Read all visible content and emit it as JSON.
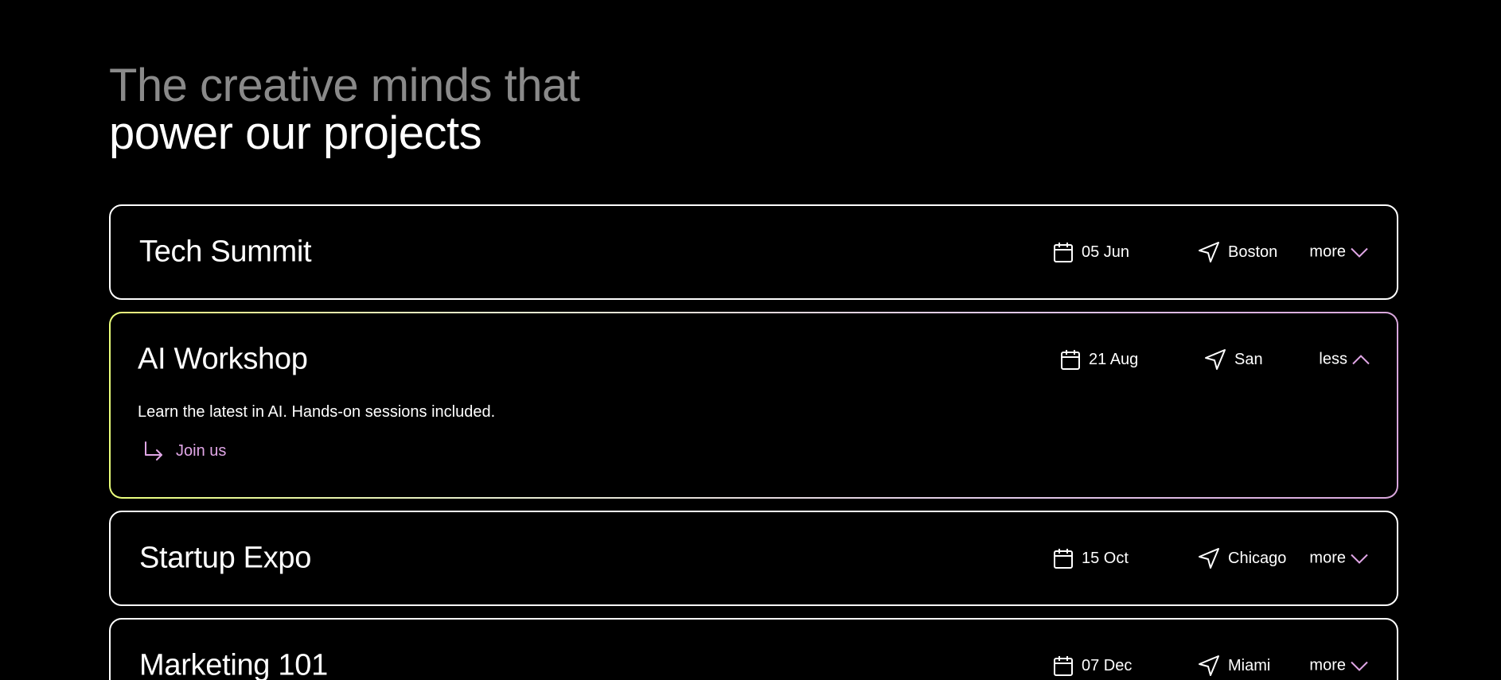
{
  "heading": {
    "line1": "The creative minds that",
    "line2": "power our projects"
  },
  "colors": {
    "background": "#000000",
    "muted_text": "#8a8a8a",
    "accent_pink": "#e0a6e6",
    "accent_lime": "#eaff7a"
  },
  "events": [
    {
      "title": "Tech Summit",
      "date": "05 Jun",
      "location": "Boston",
      "toggle_label": "more",
      "expanded": false
    },
    {
      "title": "AI Workshop",
      "date": "21 Aug",
      "location": "San",
      "toggle_label": "less",
      "expanded": true,
      "description": "Learn the latest in AI. Hands-on sessions included.",
      "cta_label": "Join us"
    },
    {
      "title": "Startup Expo",
      "date": "15 Oct",
      "location": "Chicago",
      "toggle_label": "more",
      "expanded": false
    },
    {
      "title": "Marketing 101",
      "date": "07 Dec",
      "location": "Miami",
      "toggle_label": "more",
      "expanded": false
    }
  ],
  "icons": {
    "date": "calendar-icon",
    "location": "navigation-arrow-icon",
    "more": "chevron-down-icon",
    "less": "chevron-up-icon",
    "cta": "arrow-return-right-icon"
  }
}
